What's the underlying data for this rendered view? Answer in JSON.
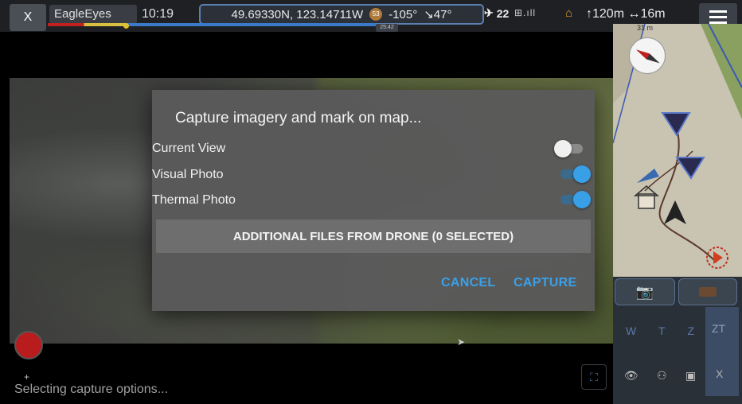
{
  "topbar": {
    "close_label": "X",
    "app_name": "EagleEyes",
    "time": "10:19",
    "coordinates": "49.69330N, 123.14711W",
    "gimbal_badge": "53",
    "heading": "-105°",
    "pitch": "↘47°",
    "satellites": "22",
    "signal": "⊞.ıll",
    "altitude": "↑120m",
    "distance": "↔16m",
    "battery_time": "25:42",
    "battery_level_pct": 24
  },
  "minimap": {
    "scale": "31 m"
  },
  "dialog": {
    "title": "Capture imagery and mark on map...",
    "options": [
      {
        "label": "Current View",
        "on": false
      },
      {
        "label": "Visual Photo",
        "on": true
      },
      {
        "label": "Thermal Photo",
        "on": true
      }
    ],
    "files_button": "ADDITIONAL FILES FROM DRONE (0 SELECTED)",
    "cancel_label": "CANCEL",
    "capture_label": "CAPTURE"
  },
  "controls": {
    "zoom": [
      "W",
      "T",
      "Z"
    ],
    "zt_label": "ZT",
    "close_small": "X"
  },
  "status": {
    "plus": "+",
    "text": "Selecting capture options..."
  },
  "colors": {
    "accent": "#3aa0e8",
    "record": "#b81c1c",
    "dialog_bg": "#5a5a5a"
  }
}
